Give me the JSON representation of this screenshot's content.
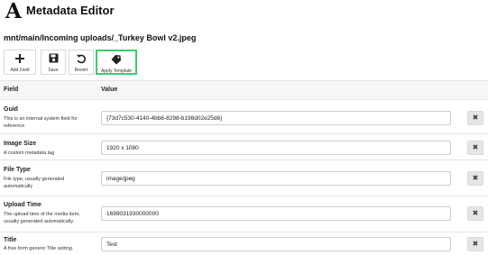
{
  "app": {
    "logo": "A",
    "title": "Metadata Editor"
  },
  "file_path": "mnt/main/Incoming uploads/_Turkey Bowl v2.jpeg",
  "toolbar": {
    "add_field": "Add Field",
    "save": "Save",
    "revert": "Revert",
    "apply_template": "Apply Template",
    "highlight_color": "#3ccc6e"
  },
  "table": {
    "col_field": "Field",
    "col_value": "Value"
  },
  "rows": [
    {
      "name": "Guid",
      "desc": "This is an internal system field for reference",
      "value": "{73d7c530-4140-4bb6-8298-b198d02e25d6}"
    },
    {
      "name": "Image Size",
      "desc": "A custom metadata tag",
      "value": "1920 x 1080"
    },
    {
      "name": "File Type",
      "desc": "File type, usually generated automatically",
      "value": "image/jpeg"
    },
    {
      "name": "Upload Time",
      "desc": "The upload time of the media item, usually generated automatically.",
      "value": "1699031930000000"
    },
    {
      "name": "Title",
      "desc": "A free form generic Title setting.",
      "value": "Test"
    }
  ],
  "delete_glyph": "✖"
}
